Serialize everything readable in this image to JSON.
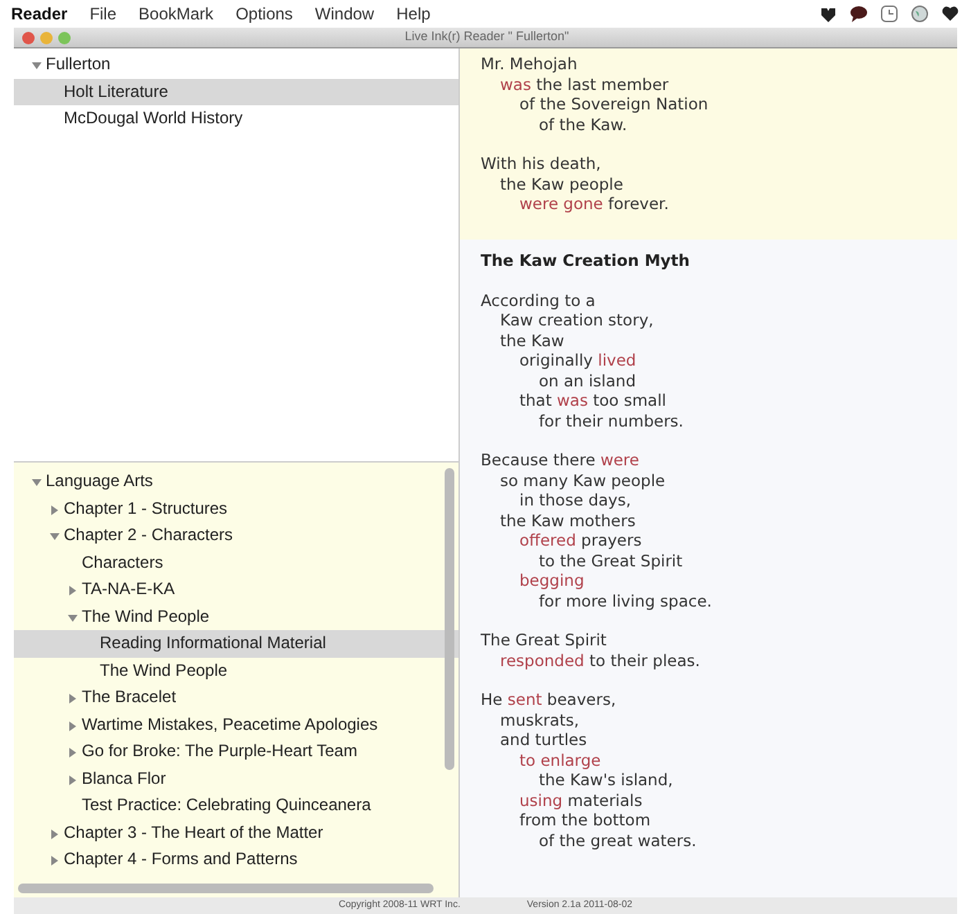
{
  "menu_bar": {
    "app_name": "Reader",
    "items": [
      "File",
      "BookMark",
      "Options",
      "Window",
      "Help"
    ]
  },
  "window": {
    "title": "Live Ink(r) Reader \" Fullerton\""
  },
  "library_tree": [
    {
      "label": "Fullerton",
      "expanded": true,
      "selected": false,
      "children": [
        {
          "label": "Holt Literature",
          "selected": true
        },
        {
          "label": "McDougal World History",
          "selected": false
        }
      ]
    }
  ],
  "contents_tree": [
    {
      "label": "Language Arts",
      "expanded": true,
      "selected": false,
      "children": [
        {
          "label": "Chapter 1 - Structures",
          "expanded": false,
          "selected": false
        },
        {
          "label": "Chapter 2 - Characters",
          "expanded": true,
          "selected": false,
          "children": [
            {
              "label": "Characters",
              "selected": false
            },
            {
              "label": "TA-NA-E-KA",
              "expanded": false,
              "selected": false
            },
            {
              "label": "The Wind People",
              "expanded": true,
              "selected": false,
              "children": [
                {
                  "label": "Reading Informational Material",
                  "selected": true
                },
                {
                  "label": "The Wind People",
                  "selected": false
                }
              ]
            },
            {
              "label": "The Bracelet",
              "expanded": false,
              "selected": false
            },
            {
              "label": "Wartime Mistakes, Peacetime Apologies",
              "expanded": false,
              "selected": false
            },
            {
              "label": "Go for Broke: The Purple-Heart Team",
              "expanded": false,
              "selected": false
            },
            {
              "label": "Blanca Flor",
              "expanded": false,
              "selected": false
            },
            {
              "label": "Test Practice: Celebrating Quinceanera",
              "selected": false
            }
          ]
        },
        {
          "label": "Chapter 3 - The Heart of the Matter",
          "expanded": false,
          "selected": false
        },
        {
          "label": "Chapter 4 - Forms and Patterns",
          "expanded": false,
          "selected": false
        }
      ]
    }
  ],
  "reading": {
    "sections": [
      {
        "highlighted": true,
        "blocks": [
          {
            "kind": "stanza",
            "lines": [
              {
                "segments": [
                  {
                    "text": "Mr. Mehojah",
                    "verb": false
                  }
                ],
                "children": [
                  {
                    "segments": [
                      {
                        "text": "was",
                        "verb": true
                      },
                      {
                        "text": " the last member",
                        "verb": false
                      }
                    ],
                    "children": [
                      {
                        "segments": [
                          {
                            "text": "of the Sovereign Nation",
                            "verb": false
                          }
                        ],
                        "children": [
                          {
                            "segments": [
                              {
                                "text": "of the Kaw.",
                                "verb": false
                              }
                            ]
                          }
                        ]
                      }
                    ]
                  }
                ]
              }
            ]
          },
          {
            "kind": "stanza",
            "lines": [
              {
                "segments": [
                  {
                    "text": "With his death,",
                    "verb": false
                  }
                ],
                "children": [
                  {
                    "segments": [
                      {
                        "text": "the Kaw people",
                        "verb": false
                      }
                    ],
                    "children": [
                      {
                        "segments": [
                          {
                            "text": "were gone",
                            "verb": true
                          },
                          {
                            "text": " forever.",
                            "verb": false
                          }
                        ]
                      }
                    ]
                  }
                ]
              }
            ]
          }
        ]
      },
      {
        "highlighted": false,
        "blocks": [
          {
            "kind": "heading",
            "text": "The Kaw Creation Myth"
          },
          {
            "kind": "stanza",
            "lines": [
              {
                "segments": [
                  {
                    "text": "According to a",
                    "verb": false
                  }
                ],
                "children": [
                  {
                    "segments": [
                      {
                        "text": "Kaw creation story,",
                        "verb": false
                      }
                    ]
                  },
                  {
                    "segments": [
                      {
                        "text": "the Kaw",
                        "verb": false
                      }
                    ],
                    "children": [
                      {
                        "segments": [
                          {
                            "text": "originally ",
                            "verb": false
                          },
                          {
                            "text": "lived",
                            "verb": true
                          }
                        ],
                        "children": [
                          {
                            "segments": [
                              {
                                "text": "on an island",
                                "verb": false
                              }
                            ]
                          }
                        ]
                      },
                      {
                        "segments": [
                          {
                            "text": "that ",
                            "verb": false
                          },
                          {
                            "text": "was",
                            "verb": true
                          },
                          {
                            "text": " too small",
                            "verb": false
                          }
                        ],
                        "children": [
                          {
                            "segments": [
                              {
                                "text": "for their numbers.",
                                "verb": false
                              }
                            ]
                          }
                        ]
                      }
                    ]
                  }
                ]
              }
            ]
          },
          {
            "kind": "stanza",
            "lines": [
              {
                "segments": [
                  {
                    "text": "Because there ",
                    "verb": false
                  },
                  {
                    "text": "were",
                    "verb": true
                  }
                ],
                "children": [
                  {
                    "segments": [
                      {
                        "text": "so many Kaw people",
                        "verb": false
                      }
                    ],
                    "children": [
                      {
                        "segments": [
                          {
                            "text": "in those days,",
                            "verb": false
                          }
                        ]
                      }
                    ]
                  },
                  {
                    "segments": [
                      {
                        "text": "the Kaw mothers",
                        "verb": false
                      }
                    ],
                    "children": [
                      {
                        "segments": [
                          {
                            "text": "offered",
                            "verb": true
                          },
                          {
                            "text": " prayers",
                            "verb": false
                          }
                        ],
                        "children": [
                          {
                            "segments": [
                              {
                                "text": "to the Great Spirit",
                                "verb": false
                              }
                            ]
                          }
                        ]
                      },
                      {
                        "segments": [
                          {
                            "text": "begging",
                            "verb": true
                          }
                        ],
                        "children": [
                          {
                            "segments": [
                              {
                                "text": "for more living space.",
                                "verb": false
                              }
                            ]
                          }
                        ]
                      }
                    ]
                  }
                ]
              }
            ]
          },
          {
            "kind": "stanza",
            "lines": [
              {
                "segments": [
                  {
                    "text": "The Great Spirit",
                    "verb": false
                  }
                ],
                "children": [
                  {
                    "segments": [
                      {
                        "text": "responded",
                        "verb": true
                      },
                      {
                        "text": " to their pleas.",
                        "verb": false
                      }
                    ]
                  }
                ]
              }
            ]
          },
          {
            "kind": "stanza",
            "lines": [
              {
                "segments": [
                  {
                    "text": "He ",
                    "verb": false
                  },
                  {
                    "text": "sent",
                    "verb": true
                  },
                  {
                    "text": " beavers,",
                    "verb": false
                  }
                ],
                "children": [
                  {
                    "segments": [
                      {
                        "text": "muskrats,",
                        "verb": false
                      }
                    ]
                  },
                  {
                    "segments": [
                      {
                        "text": "and turtles",
                        "verb": false
                      }
                    ],
                    "children": [
                      {
                        "segments": [
                          {
                            "text": "to enlarge",
                            "verb": true
                          }
                        ],
                        "children": [
                          {
                            "segments": [
                              {
                                "text": "the Kaw's island,",
                                "verb": false
                              }
                            ]
                          }
                        ]
                      },
                      {
                        "segments": [
                          {
                            "text": "using",
                            "verb": true
                          },
                          {
                            "text": " materials",
                            "verb": false
                          }
                        ]
                      },
                      {
                        "segments": [
                          {
                            "text": "from the bottom",
                            "verb": false
                          }
                        ],
                        "children": [
                          {
                            "segments": [
                              {
                                "text": "of the great waters.",
                                "verb": false
                              }
                            ]
                          }
                        ]
                      }
                    ]
                  }
                ]
              }
            ]
          }
        ]
      }
    ]
  },
  "status_bar": {
    "copyright": "Copyright 2008-11 WRT Inc.",
    "version": "Version 2.1a 2011-08-02"
  }
}
